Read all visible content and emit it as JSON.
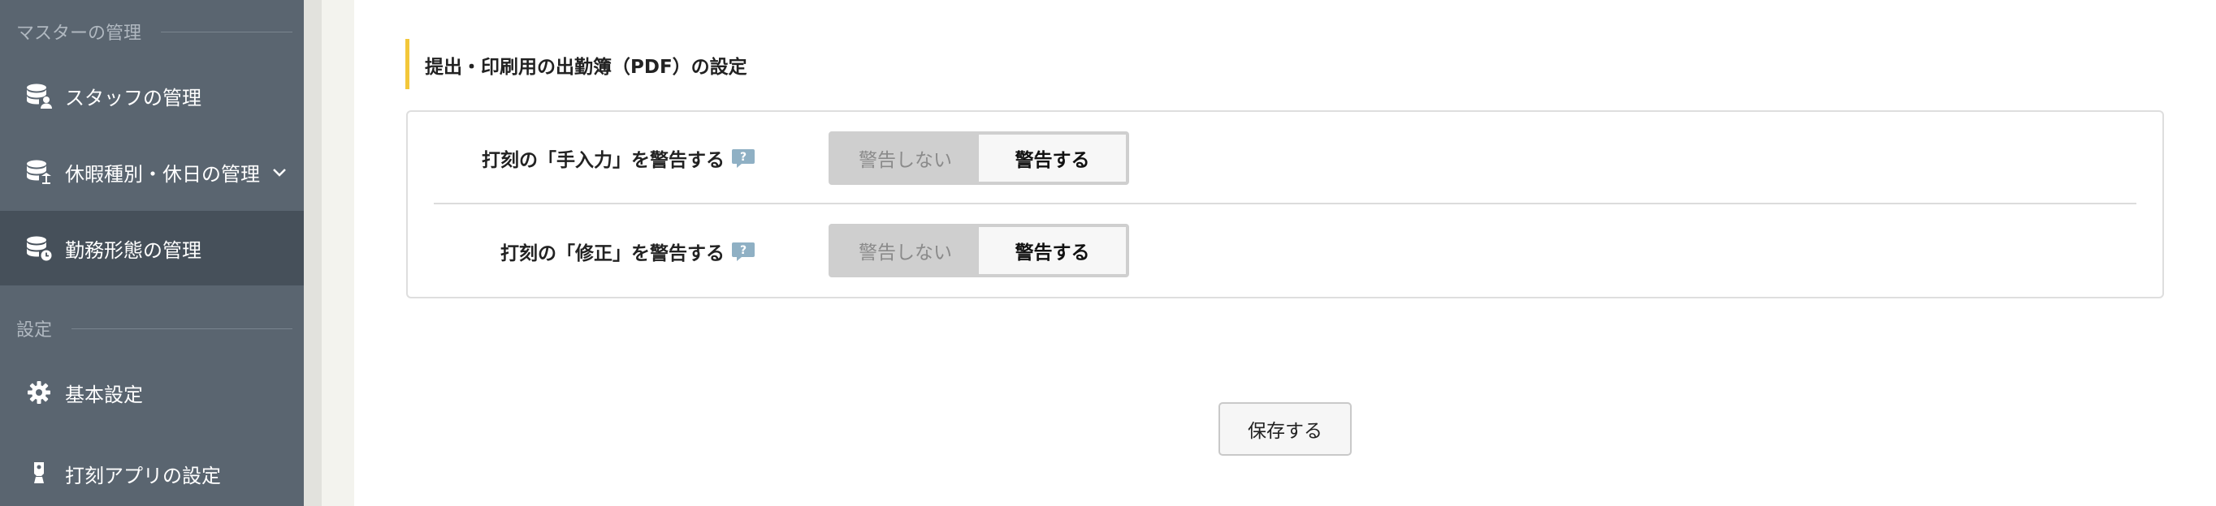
{
  "sidebar": {
    "sections": [
      {
        "label": "マスターの管理"
      },
      {
        "label": "設定"
      }
    ],
    "items": [
      {
        "label": "スタッフの管理",
        "icon": "database-user-icon"
      },
      {
        "label": "休暇種別・休日の管理",
        "icon": "database-calendar-icon"
      },
      {
        "label": "勤務形態の管理",
        "icon": "database-clock-icon",
        "active": true
      },
      {
        "label": "基本設定",
        "icon": "gear-icon"
      },
      {
        "label": "打刻アプリの設定",
        "icon": "stamp-app-icon"
      }
    ]
  },
  "main": {
    "section_title": "提出・印刷用の出勤簿（PDF）の設定",
    "rows": [
      {
        "label": "打刻の「手入力」を警告する",
        "options": [
          "警告しない",
          "警告する"
        ],
        "selected": "警告する"
      },
      {
        "label": "打刻の「修正」を警告する",
        "options": [
          "警告しない",
          "警告する"
        ],
        "selected": "警告する"
      }
    ],
    "save_label": "保存する"
  },
  "colors": {
    "sidebar_bg": "#5a6570",
    "sidebar_active_bg": "#46505a",
    "accent_bar": "#f3c73a",
    "help_icon": "#8fb0c4"
  }
}
